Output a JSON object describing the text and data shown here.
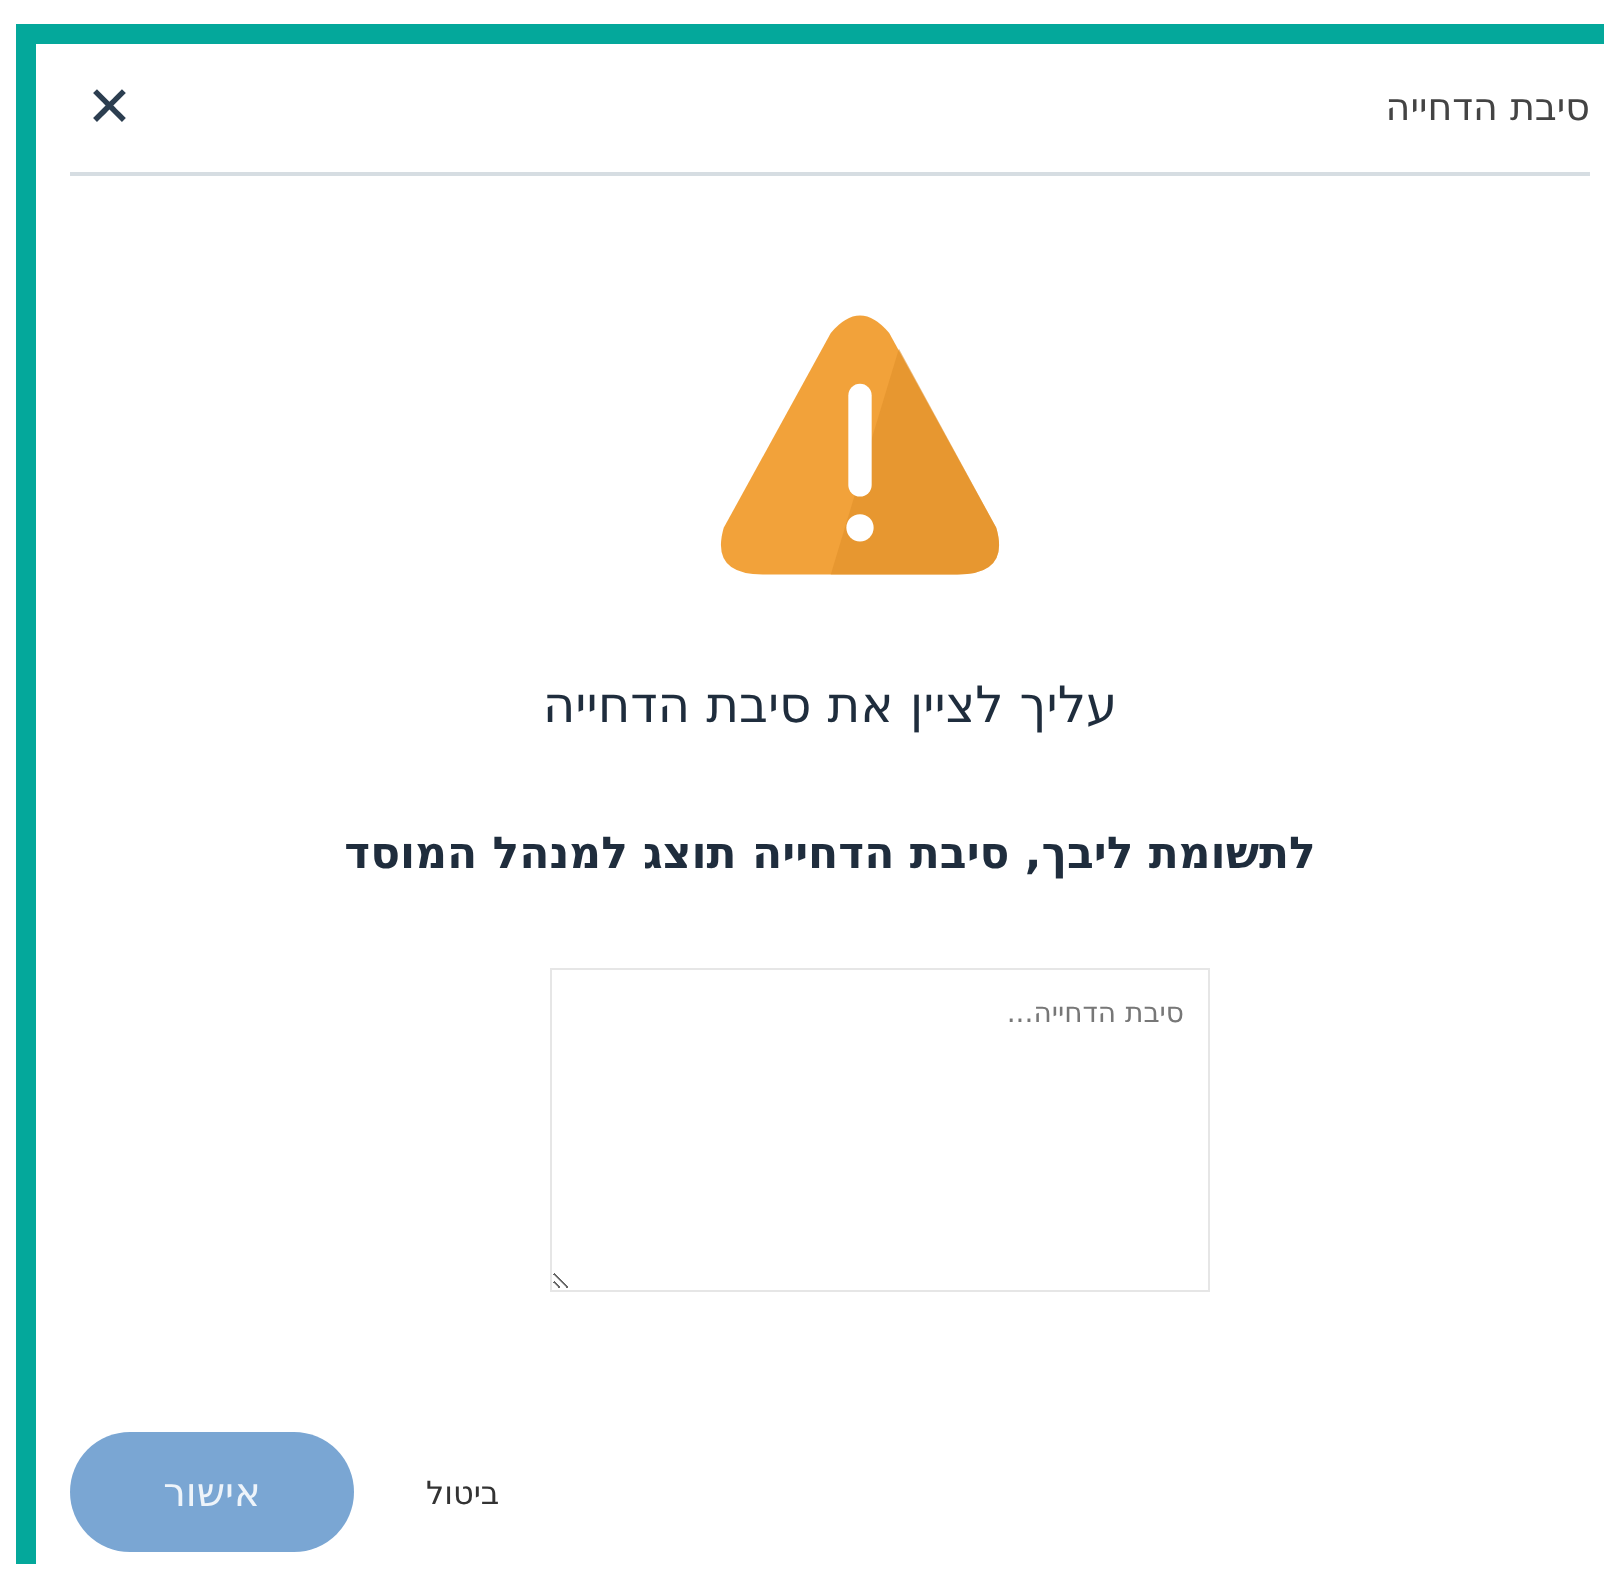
{
  "dialog": {
    "title": "סיבת הדחייה",
    "close_symbol": "✕",
    "heading": "עליך לציין את סיבת הדחייה",
    "message": "לתשומת ליבך, סיבת הדחייה תוצג למנהל המוסד",
    "reason_field": {
      "placeholder": "סיבת הדחייה..."
    },
    "buttons": [
      {
        "kind": "cancel",
        "label": "ביטול",
        "disabled": false
      },
      {
        "kind": "confirm",
        "label": "אישור",
        "disabled": true
      }
    ]
  }
}
